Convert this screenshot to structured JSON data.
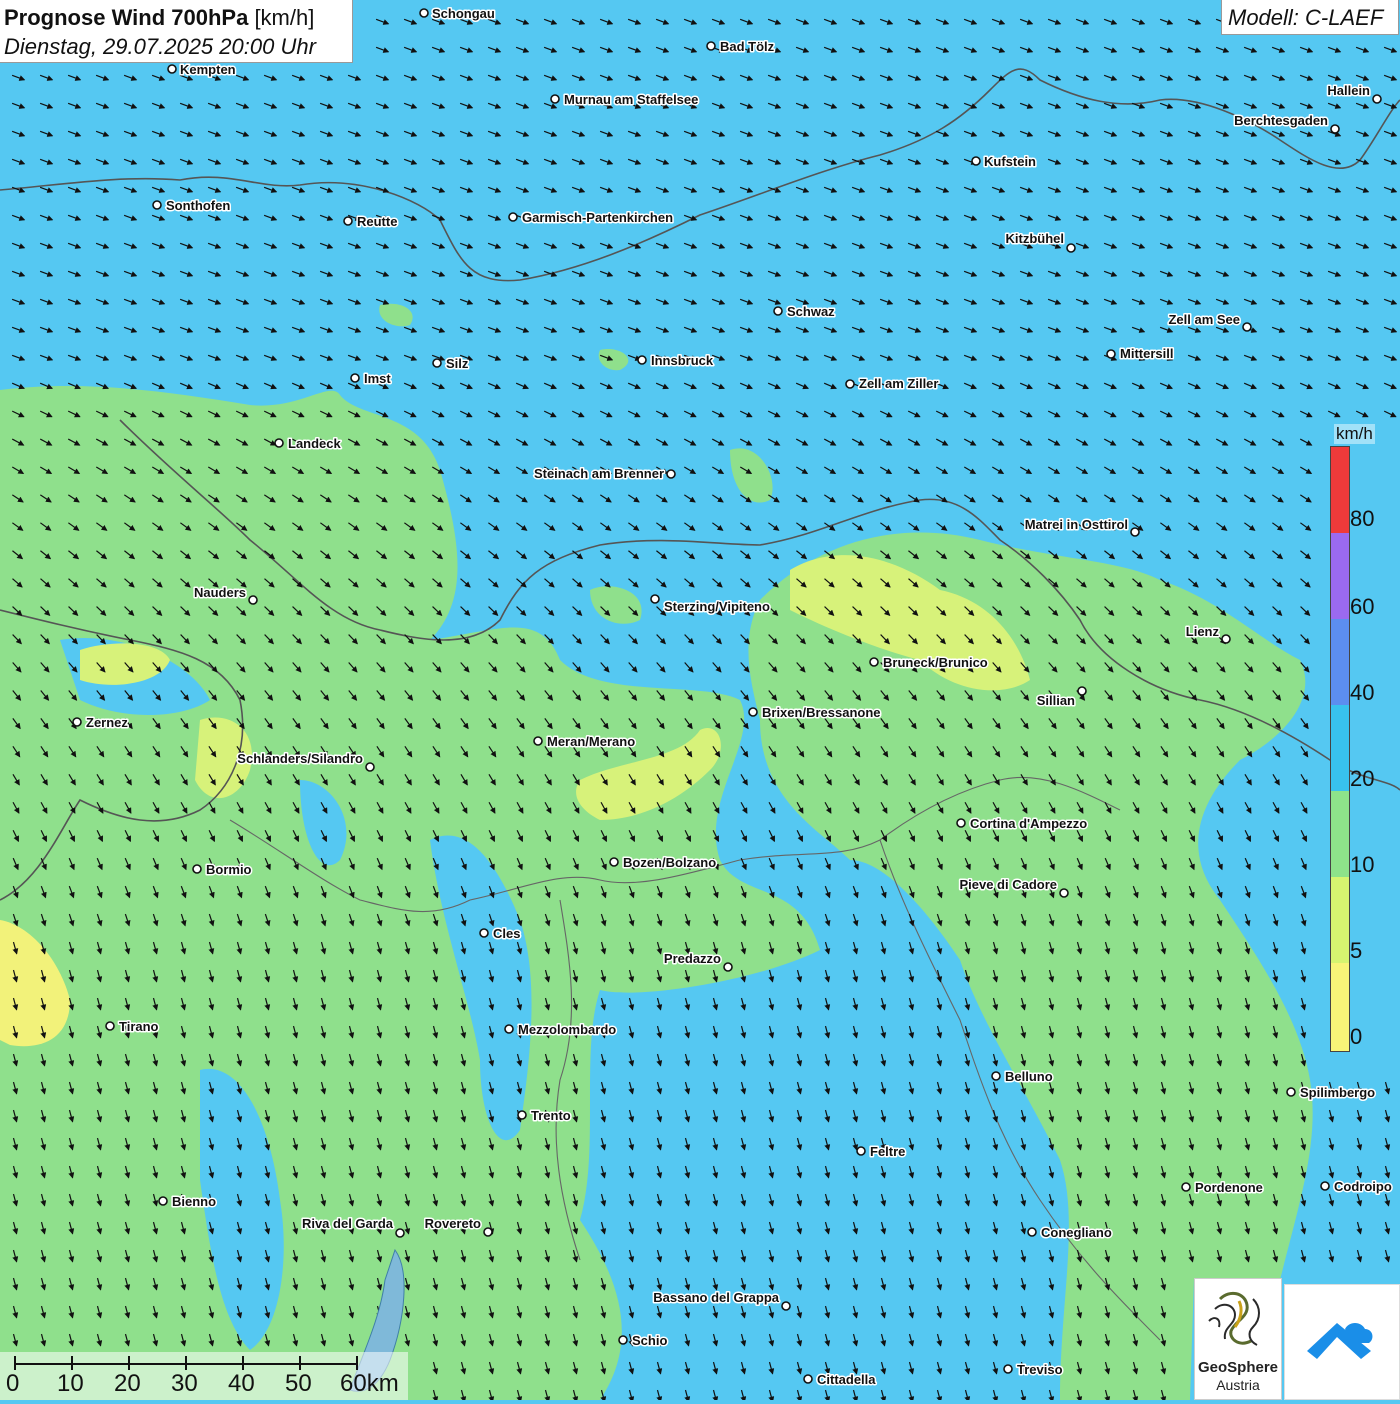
{
  "header": {
    "title_bold": "Prognose Wind 700hPa",
    "title_unit": "[km/h]",
    "datetime": "Dienstag, 29.07.2025 20:00 Uhr",
    "model": "Modell: C-LAEF"
  },
  "legend": {
    "unit": "km/h",
    "ticks": [
      "80",
      "60",
      "40",
      "20",
      "10",
      "5",
      "0"
    ],
    "colors": [
      "#ef3a3a",
      "#9b6af0",
      "#5c8ef0",
      "#38c2ee",
      "#8ee38a",
      "#d6f570",
      "#f8f578"
    ]
  },
  "scale_bar": {
    "labels": [
      "0",
      "10",
      "20",
      "30",
      "40",
      "50",
      "60km"
    ]
  },
  "logo": {
    "line1": "GeoSphere",
    "line2": "Austria"
  },
  "cities": [
    {
      "name": "Schongau"
    },
    {
      "name": "Bad Tölz"
    },
    {
      "name": "Kempten"
    },
    {
      "name": "Murnau am Staffelsee"
    },
    {
      "name": "Hallein"
    },
    {
      "name": "Berchtesgaden"
    },
    {
      "name": "Kufstein"
    },
    {
      "name": "Sonthofen"
    },
    {
      "name": "Reutte"
    },
    {
      "name": "Garmisch-Partenkirchen"
    },
    {
      "name": "Kitzbühel"
    },
    {
      "name": "Schwaz"
    },
    {
      "name": "Zell am See"
    },
    {
      "name": "Innsbruck"
    },
    {
      "name": "Mittersill"
    },
    {
      "name": "Silz"
    },
    {
      "name": "Imst"
    },
    {
      "name": "Zell am Ziller"
    },
    {
      "name": "Landeck"
    },
    {
      "name": "Steinach am Brenner"
    },
    {
      "name": "Matrei in Osttirol"
    },
    {
      "name": "Nauders"
    },
    {
      "name": "Sterzing/Vipiteno"
    },
    {
      "name": "Lienz"
    },
    {
      "name": "Bruneck/Brunico"
    },
    {
      "name": "Sillian"
    },
    {
      "name": "Brixen/Bressanone"
    },
    {
      "name": "Zernez"
    },
    {
      "name": "Meran/Merano"
    },
    {
      "name": "Schlanders/Silandro"
    },
    {
      "name": "Cortina d'Ampezzo"
    },
    {
      "name": "Bozen/Bolzano"
    },
    {
      "name": "Bormio"
    },
    {
      "name": "Pieve di Cadore"
    },
    {
      "name": "Cles"
    },
    {
      "name": "Predazzo"
    },
    {
      "name": "Tirano"
    },
    {
      "name": "Mezzolombardo"
    },
    {
      "name": "Belluno"
    },
    {
      "name": "Spilimbergo"
    },
    {
      "name": "Trento"
    },
    {
      "name": "Feltre"
    },
    {
      "name": "Bienno"
    },
    {
      "name": "Pordenone"
    },
    {
      "name": "Codroipo"
    },
    {
      "name": "Riva del Garda"
    },
    {
      "name": "Rovereto"
    },
    {
      "name": "Conegliano"
    },
    {
      "name": "Bassano del Grappa"
    },
    {
      "name": "Schio"
    },
    {
      "name": "Treviso"
    },
    {
      "name": "Cittadella"
    }
  ]
}
